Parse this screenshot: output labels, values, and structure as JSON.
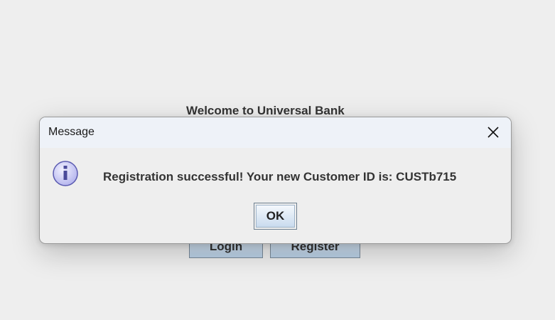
{
  "background": {
    "title": "Welcome to Universal Bank",
    "login_label": "Login",
    "register_label": "Register"
  },
  "dialog": {
    "title": "Message",
    "close_icon": "close-icon",
    "info_icon": "info-icon",
    "message": "Registration successful! Your new Customer ID is: CUSTb715",
    "ok_label": "OK"
  },
  "colors": {
    "window_bg": "#eeeeee",
    "titlebar_bg": "#eef2f8",
    "button_gradient_top": "#dde8f3",
    "button_gradient_bottom": "#b8cfe5",
    "info_icon_fill": "#c8c8f5",
    "info_icon_stroke": "#5a5ab0"
  }
}
